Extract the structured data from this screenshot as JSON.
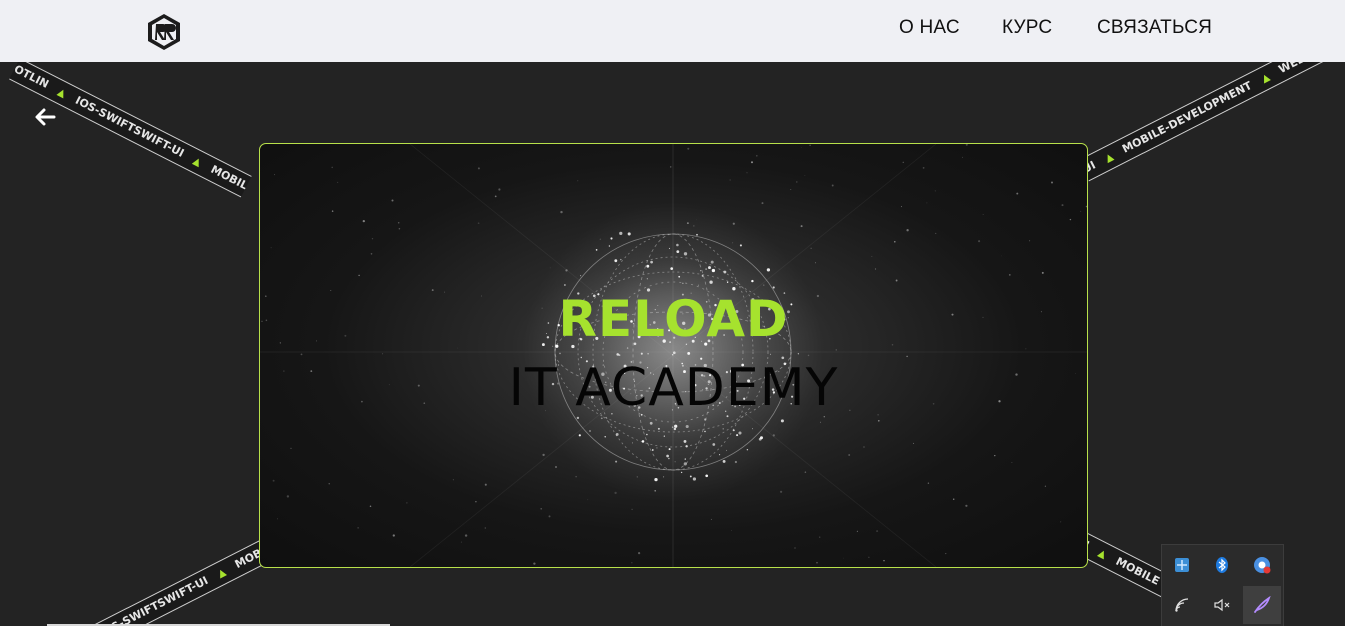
{
  "header": {
    "logo": "rr-hexagon-logo",
    "nav": [
      {
        "label": "О НАС"
      },
      {
        "label": "КУРС"
      },
      {
        "label": "СВЯЗАТЬСЯ"
      }
    ]
  },
  "ribbons": {
    "top_left": [
      "OTLIN",
      "IOS-SWIFTSWIFT-UI",
      "MOBILE"
    ],
    "top_right": [
      "UI",
      "MOBILE-DEVELOPMENT",
      "WEB"
    ],
    "bottom_left": [
      "IOS-SWIFTSWIFT-UI",
      "MOBILE"
    ],
    "bottom_right": [
      "UI",
      "MOBILE"
    ]
  },
  "hero": {
    "line1": "RELOAD",
    "line2": "IT ACADEMY"
  },
  "tray": {
    "icons": [
      "network-app-icon",
      "bluetooth-icon",
      "chrome-icon",
      "wifi-icon",
      "muted-speaker-icon",
      "feather-app-icon"
    ]
  },
  "colors": {
    "accent": "#a6e22e",
    "header_bg": "#eff0f4",
    "page_bg": "#232323"
  }
}
